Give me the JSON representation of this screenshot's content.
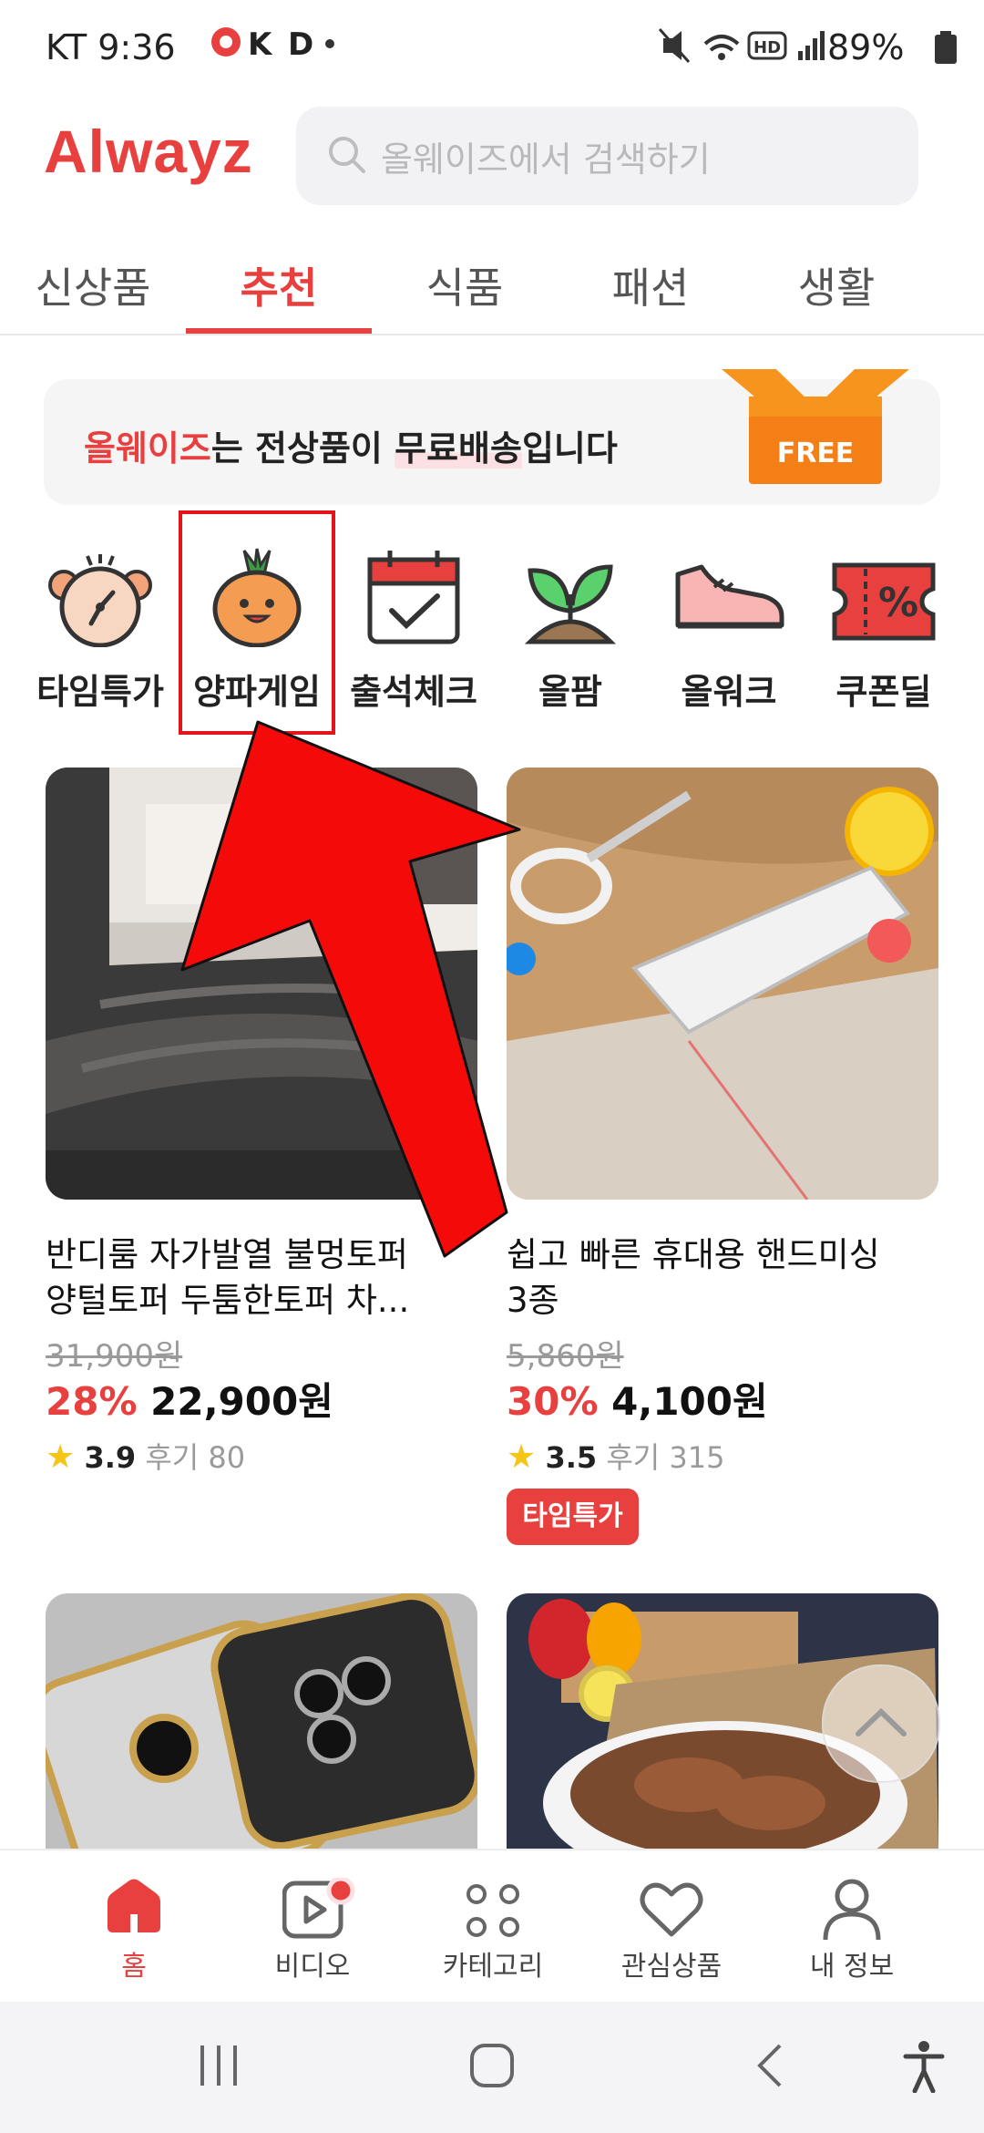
{
  "status_bar": {
    "carrier_time": "KT 9:36",
    "battery": "89%",
    "app_icons": [
      "q-icon",
      "k-icon",
      "d-icon",
      "dot"
    ]
  },
  "header": {
    "logo": "Alwayz",
    "search_placeholder": "올웨이즈에서 검색하기"
  },
  "tabs": [
    {
      "label": "신상품",
      "active": false
    },
    {
      "label": "추천",
      "active": true
    },
    {
      "label": "식품",
      "active": false
    },
    {
      "label": "패션",
      "active": false
    },
    {
      "label": "생활",
      "active": false
    }
  ],
  "banner": {
    "brand": "올웨이즈",
    "text_mid": "는 전상품이 ",
    "text_hl": "무료배송",
    "text_end": "입니다",
    "badge": "FREE"
  },
  "quick_menu": [
    {
      "label": "타임특가",
      "icon": "alarm-clock-icon"
    },
    {
      "label": "양파게임",
      "icon": "onion-icon"
    },
    {
      "label": "출석체크",
      "icon": "calendar-check-icon"
    },
    {
      "label": "올팜",
      "icon": "sprout-icon"
    },
    {
      "label": "올워크",
      "icon": "sneaker-icon"
    },
    {
      "label": "쿠폰딜",
      "icon": "coupon-icon"
    }
  ],
  "products": [
    {
      "title_line1": "반디룸 자가발열 불멍토퍼",
      "title_line2": "양털토퍼 두툼한토퍼 차...",
      "original_price": "31,900원",
      "discount": "28%",
      "price": "22,900원",
      "rating": "3.9",
      "reviews": "후기 80"
    },
    {
      "title_line1": "쉽고 빠른 휴대용 핸드미싱",
      "title_line2": "3종",
      "original_price": "5,860원",
      "discount": "30%",
      "price": "4,100원",
      "rating": "3.5",
      "reviews": "후기 315",
      "badge": "타임특가"
    }
  ],
  "bottom_nav": [
    {
      "label": "홈",
      "icon": "home-icon",
      "active": true
    },
    {
      "label": "비디오",
      "icon": "video-icon",
      "active": false
    },
    {
      "label": "카테고리",
      "icon": "category-icon",
      "active": false
    },
    {
      "label": "관심상품",
      "icon": "heart-icon",
      "active": false
    },
    {
      "label": "내 정보",
      "icon": "profile-icon",
      "active": false
    }
  ],
  "colors": {
    "accent": "#e8403f",
    "annotation": "#e5141b",
    "free_box": "#f7941d"
  }
}
